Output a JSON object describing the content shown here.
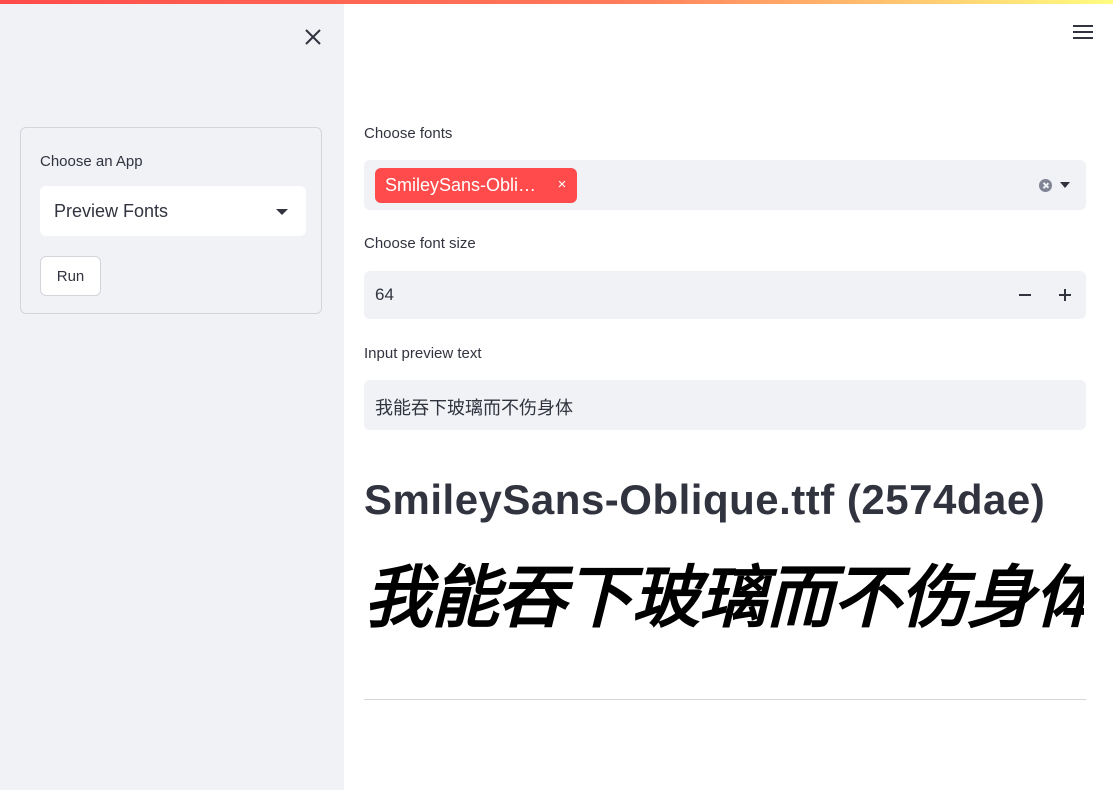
{
  "colors": {
    "primary": "#ff4b4b",
    "sidebar_bg": "#f0f2f6",
    "text": "#31333f"
  },
  "sidebar": {
    "close_icon": "close-icon",
    "app_label": "Choose an App",
    "app_selected": "Preview Fonts",
    "run_label": "Run"
  },
  "header": {
    "menu_icon": "hamburger-menu-icon"
  },
  "fonts": {
    "label": "Choose fonts",
    "selected": [
      "SmileySans-Obli…"
    ],
    "remove_symbol": "×"
  },
  "font_size": {
    "label": "Choose font size",
    "value": "64",
    "minus": "−",
    "plus": "+"
  },
  "preview_text": {
    "label": "Input preview text",
    "value": "我能吞下玻璃而不伤身体"
  },
  "preview": {
    "title": "SmileySans-Oblique.ttf (2574dae)",
    "sample": "我能吞下玻璃而不伤身体"
  }
}
